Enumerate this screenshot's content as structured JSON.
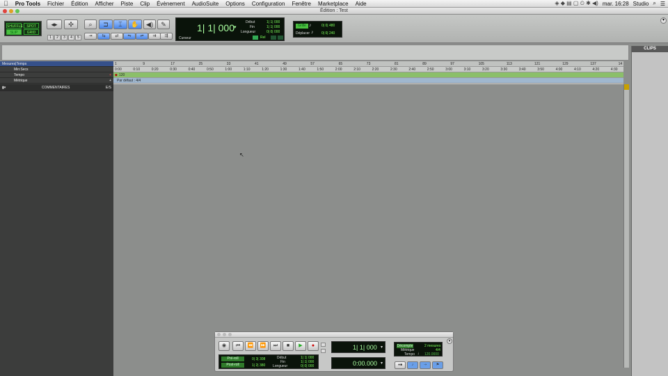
{
  "menubar": {
    "apple": "",
    "app": "Pro Tools",
    "items": [
      "Fichier",
      "Édition",
      "Afficher",
      "Piste",
      "Clip",
      "Évènement",
      "AudioSuite",
      "Options",
      "Configuration",
      "Fenêtre",
      "Marketplace",
      "Aide"
    ],
    "clock": "mar. 16:28",
    "user": "Studio"
  },
  "window": {
    "title": "Édition : Test"
  },
  "modes": {
    "shuffle": "SHUFFLE",
    "spot": "SPOT",
    "slip": "SLIP",
    "grid": "GRID",
    "nums": [
      "1",
      "2",
      "3",
      "4",
      "5"
    ]
  },
  "counter": {
    "main": "1| 1| 000",
    "label": "Curseur",
    "debut_label": "Début",
    "fin_label": "Fin",
    "longueur_label": "Longueur",
    "debut": "1| 1| 000",
    "fin": "1| 1| 000",
    "longueur": "0| 0| 000",
    "rel": "Rel"
  },
  "grid": {
    "grille_label": "Grille",
    "grille_value": "0| 0| 480",
    "deplacer_label": "Déplacer",
    "deplacer_value": "0| 0| 240"
  },
  "rulers": {
    "rows": [
      "Mesures|Temps",
      "Min:Secs",
      "Tempo",
      "Métrique"
    ],
    "tempo_value": "120",
    "meter_value": "Par défaut : 4/4",
    "bars": [
      "1",
      "9",
      "17",
      "25",
      "33",
      "41",
      "49",
      "57",
      "65",
      "73",
      "81",
      "89",
      "97",
      "105",
      "113",
      "121",
      "129",
      "137",
      "14"
    ],
    "mins": [
      "0:00",
      "0:10",
      "0:20",
      "0:30",
      "0:40",
      "0:50",
      "1:00",
      "1:10",
      "1:20",
      "1:30",
      "1:40",
      "1:50",
      "2:00",
      "2:10",
      "2:20",
      "2:30",
      "2:40",
      "2:50",
      "3:00",
      "3:10",
      "3:20",
      "3:30",
      "3:40",
      "3:50",
      "4:00",
      "4:10",
      "4:20",
      "4:30"
    ]
  },
  "tracklist": {
    "comment": "COMMENTAIRES",
    "io": "E/S"
  },
  "clips": {
    "title": "CLIPS"
  },
  "transport": {
    "preroll_label": "Pré-roll",
    "postroll_label": "Post-roll",
    "preroll": "0| 3| 308",
    "postroll": "1| 2| 380",
    "debut_label": "Début",
    "fin_label": "Fin",
    "longueur_label": "Longueur",
    "debut": "1| 1| 000",
    "fin": "1| 1| 000",
    "longueur": "0| 0| 000",
    "main_counter": "1| 1| 000",
    "sub_counter": "0:00.000",
    "decompte_label": "Décompte",
    "decompte_value": "2 mesures",
    "metrique_label": "Métrique",
    "metrique_value": "4/4",
    "tempo_label": "Tempo",
    "tempo_value": "120.0000"
  }
}
